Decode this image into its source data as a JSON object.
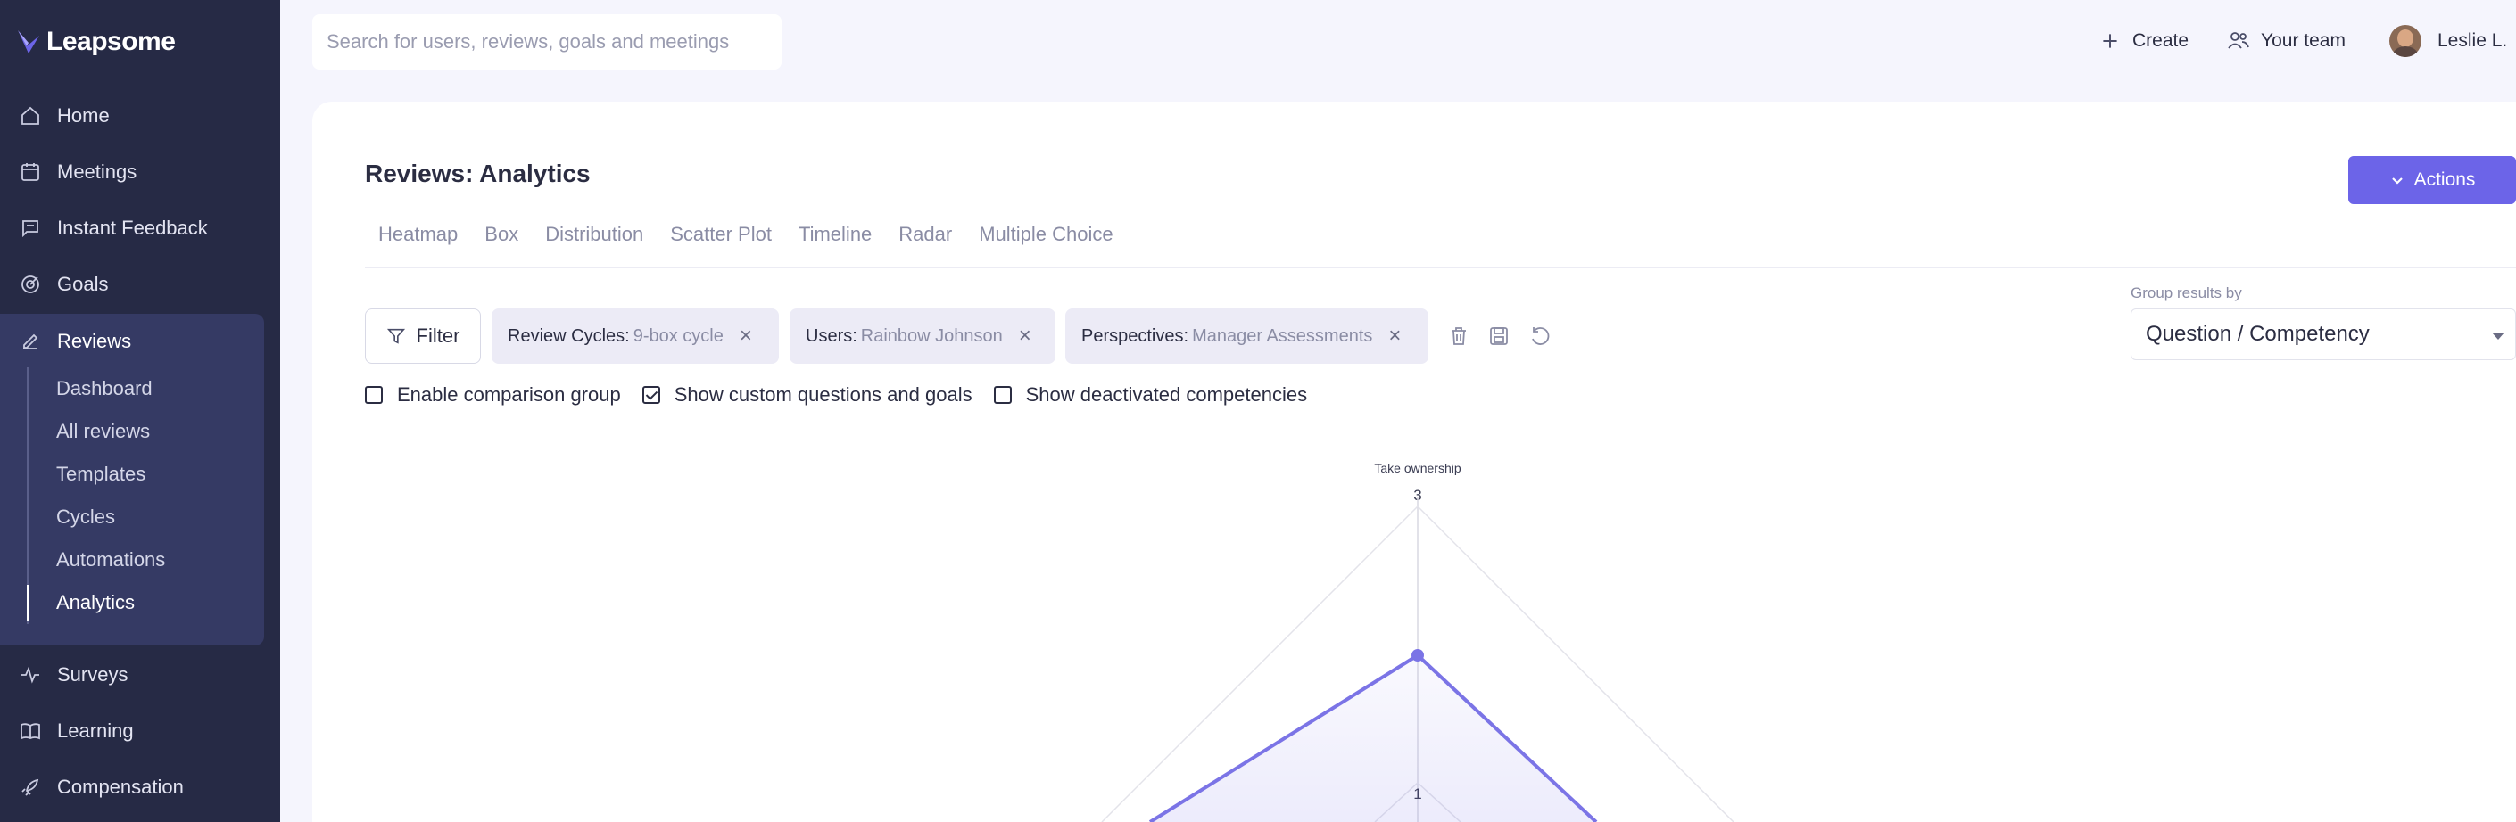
{
  "sidebar": {
    "logo": "Leapsome",
    "items": [
      {
        "label": "Home"
      },
      {
        "label": "Meetings"
      },
      {
        "label": "Instant Feedback"
      },
      {
        "label": "Goals"
      },
      {
        "label": "Reviews"
      },
      {
        "label": "Surveys"
      },
      {
        "label": "Learning"
      },
      {
        "label": "Compensation"
      }
    ],
    "reviews_sub": [
      "Dashboard",
      "All reviews",
      "Templates",
      "Cycles",
      "Automations",
      "Analytics"
    ],
    "active_sub": "Analytics"
  },
  "topbar": {
    "search_placeholder": "Search for users, reviews, goals and meetings",
    "create": "Create",
    "your_team": "Your team",
    "user": "Leslie L."
  },
  "page": {
    "title": "Reviews: Analytics",
    "actions": "Actions",
    "tabs": [
      "Heatmap",
      "Box",
      "Distribution",
      "Scatter Plot",
      "Timeline",
      "Radar",
      "Multiple Choice"
    ],
    "filter": "Filter",
    "chips": [
      {
        "key": "Review Cycles:",
        "value": "9-box cycle"
      },
      {
        "key": "Users:",
        "value": "Rainbow Johnson"
      },
      {
        "key": "Perspectives:",
        "value": "Manager Assessments"
      }
    ],
    "group_label": "Group results by",
    "group_value": "Question / Competency",
    "checks": [
      {
        "label": "Enable comparison group",
        "checked": false
      },
      {
        "label": "Show custom questions and goals",
        "checked": true
      },
      {
        "label": "Show deactivated competencies",
        "checked": false
      }
    ]
  },
  "colors": {
    "sidebar": "#262a45",
    "sidebar_group": "#353a64",
    "accent": "#6c64e8",
    "series": "#7b74e6"
  },
  "chart_data": {
    "type": "radar",
    "axis_label": "Take ownership",
    "ticks": [
      "3",
      "1"
    ],
    "value": 2
  }
}
